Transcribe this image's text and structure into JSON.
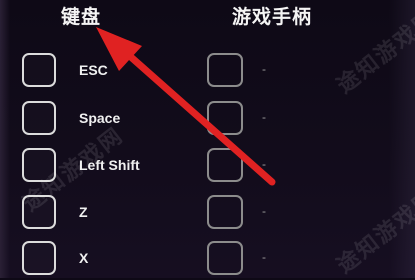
{
  "headers": {
    "keyboard": "键盘",
    "gamepad": "游戏手柄"
  },
  "rows": [
    {
      "key": "ESC",
      "gamepad": "-"
    },
    {
      "key": "Space",
      "gamepad": "-"
    },
    {
      "key": "Left Shift",
      "gamepad": "-"
    },
    {
      "key": "Z",
      "gamepad": "-"
    },
    {
      "key": "X",
      "gamepad": "-"
    }
  ],
  "watermark": "途知游戏网",
  "colors": {
    "background": "#120c1b",
    "arrow": "#e02222",
    "checkbox_border": "#dcdcdc"
  }
}
